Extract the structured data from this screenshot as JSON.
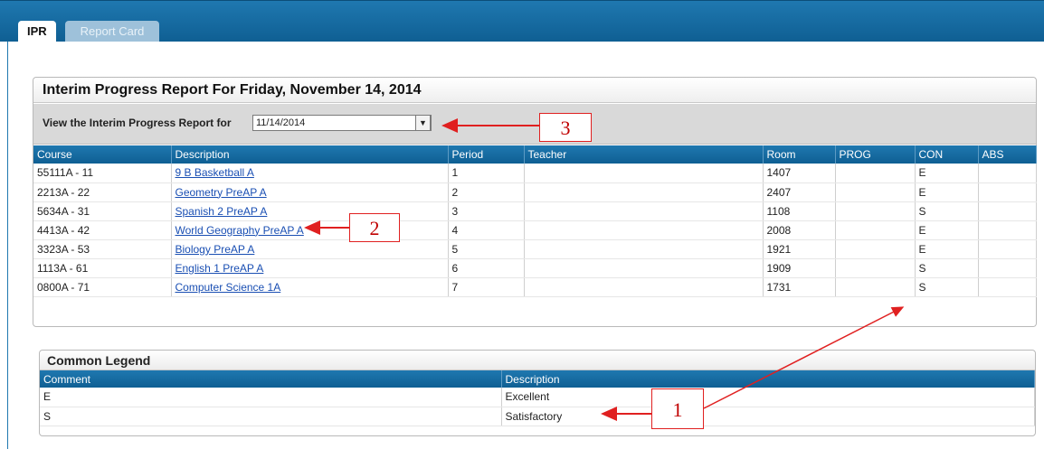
{
  "tabs": [
    {
      "label": "IPR",
      "active": true
    },
    {
      "label": "Report Card",
      "active": false
    }
  ],
  "report": {
    "title": "Interim Progress Report For Friday, November 14, 2014",
    "filter_label": "View the Interim Progress Report for",
    "selected_date": "11/14/2014"
  },
  "courses": {
    "headers": [
      "Course",
      "Description",
      "Period",
      "Teacher",
      "Room",
      "PROG",
      "CON",
      "ABS"
    ],
    "rows": [
      {
        "course": "55111A - 11",
        "description": "9 B Basketball A",
        "period": "1",
        "teacher": "",
        "room": "1407",
        "prog": "",
        "con": "E",
        "abs": ""
      },
      {
        "course": "2213A - 22",
        "description": "Geometry PreAP A",
        "period": "2",
        "teacher": "",
        "room": "2407",
        "prog": "",
        "con": "E",
        "abs": ""
      },
      {
        "course": "5634A - 31",
        "description": "Spanish 2 PreAP A",
        "period": "3",
        "teacher": "",
        "room": "1108",
        "prog": "",
        "con": "S",
        "abs": ""
      },
      {
        "course": "4413A - 42",
        "description": "World Geography PreAP A",
        "period": "4",
        "teacher": "",
        "room": "2008",
        "prog": "",
        "con": "E",
        "abs": ""
      },
      {
        "course": "3323A - 53",
        "description": "Biology PreAP A",
        "period": "5",
        "teacher": "",
        "room": "1921",
        "prog": "",
        "con": "E",
        "abs": ""
      },
      {
        "course": "1113A - 61",
        "description": "English 1 PreAP A",
        "period": "6",
        "teacher": "",
        "room": "1909",
        "prog": "",
        "con": "S",
        "abs": ""
      },
      {
        "course": "0800A - 71",
        "description": "Computer Science 1A",
        "period": "7",
        "teacher": "",
        "room": "1731",
        "prog": "",
        "con": "S",
        "abs": ""
      }
    ]
  },
  "legend": {
    "title": "Common Legend",
    "headers": [
      "Comment",
      "Description"
    ],
    "rows": [
      {
        "comment": "E",
        "description": "Excellent"
      },
      {
        "comment": "S",
        "description": "Satisfactory"
      }
    ]
  },
  "annotations": [
    "1",
    "2",
    "3"
  ],
  "colors": {
    "header_blue": "#1f78b0",
    "link_blue": "#1a4fb3",
    "annotation_red": "#e02020"
  }
}
